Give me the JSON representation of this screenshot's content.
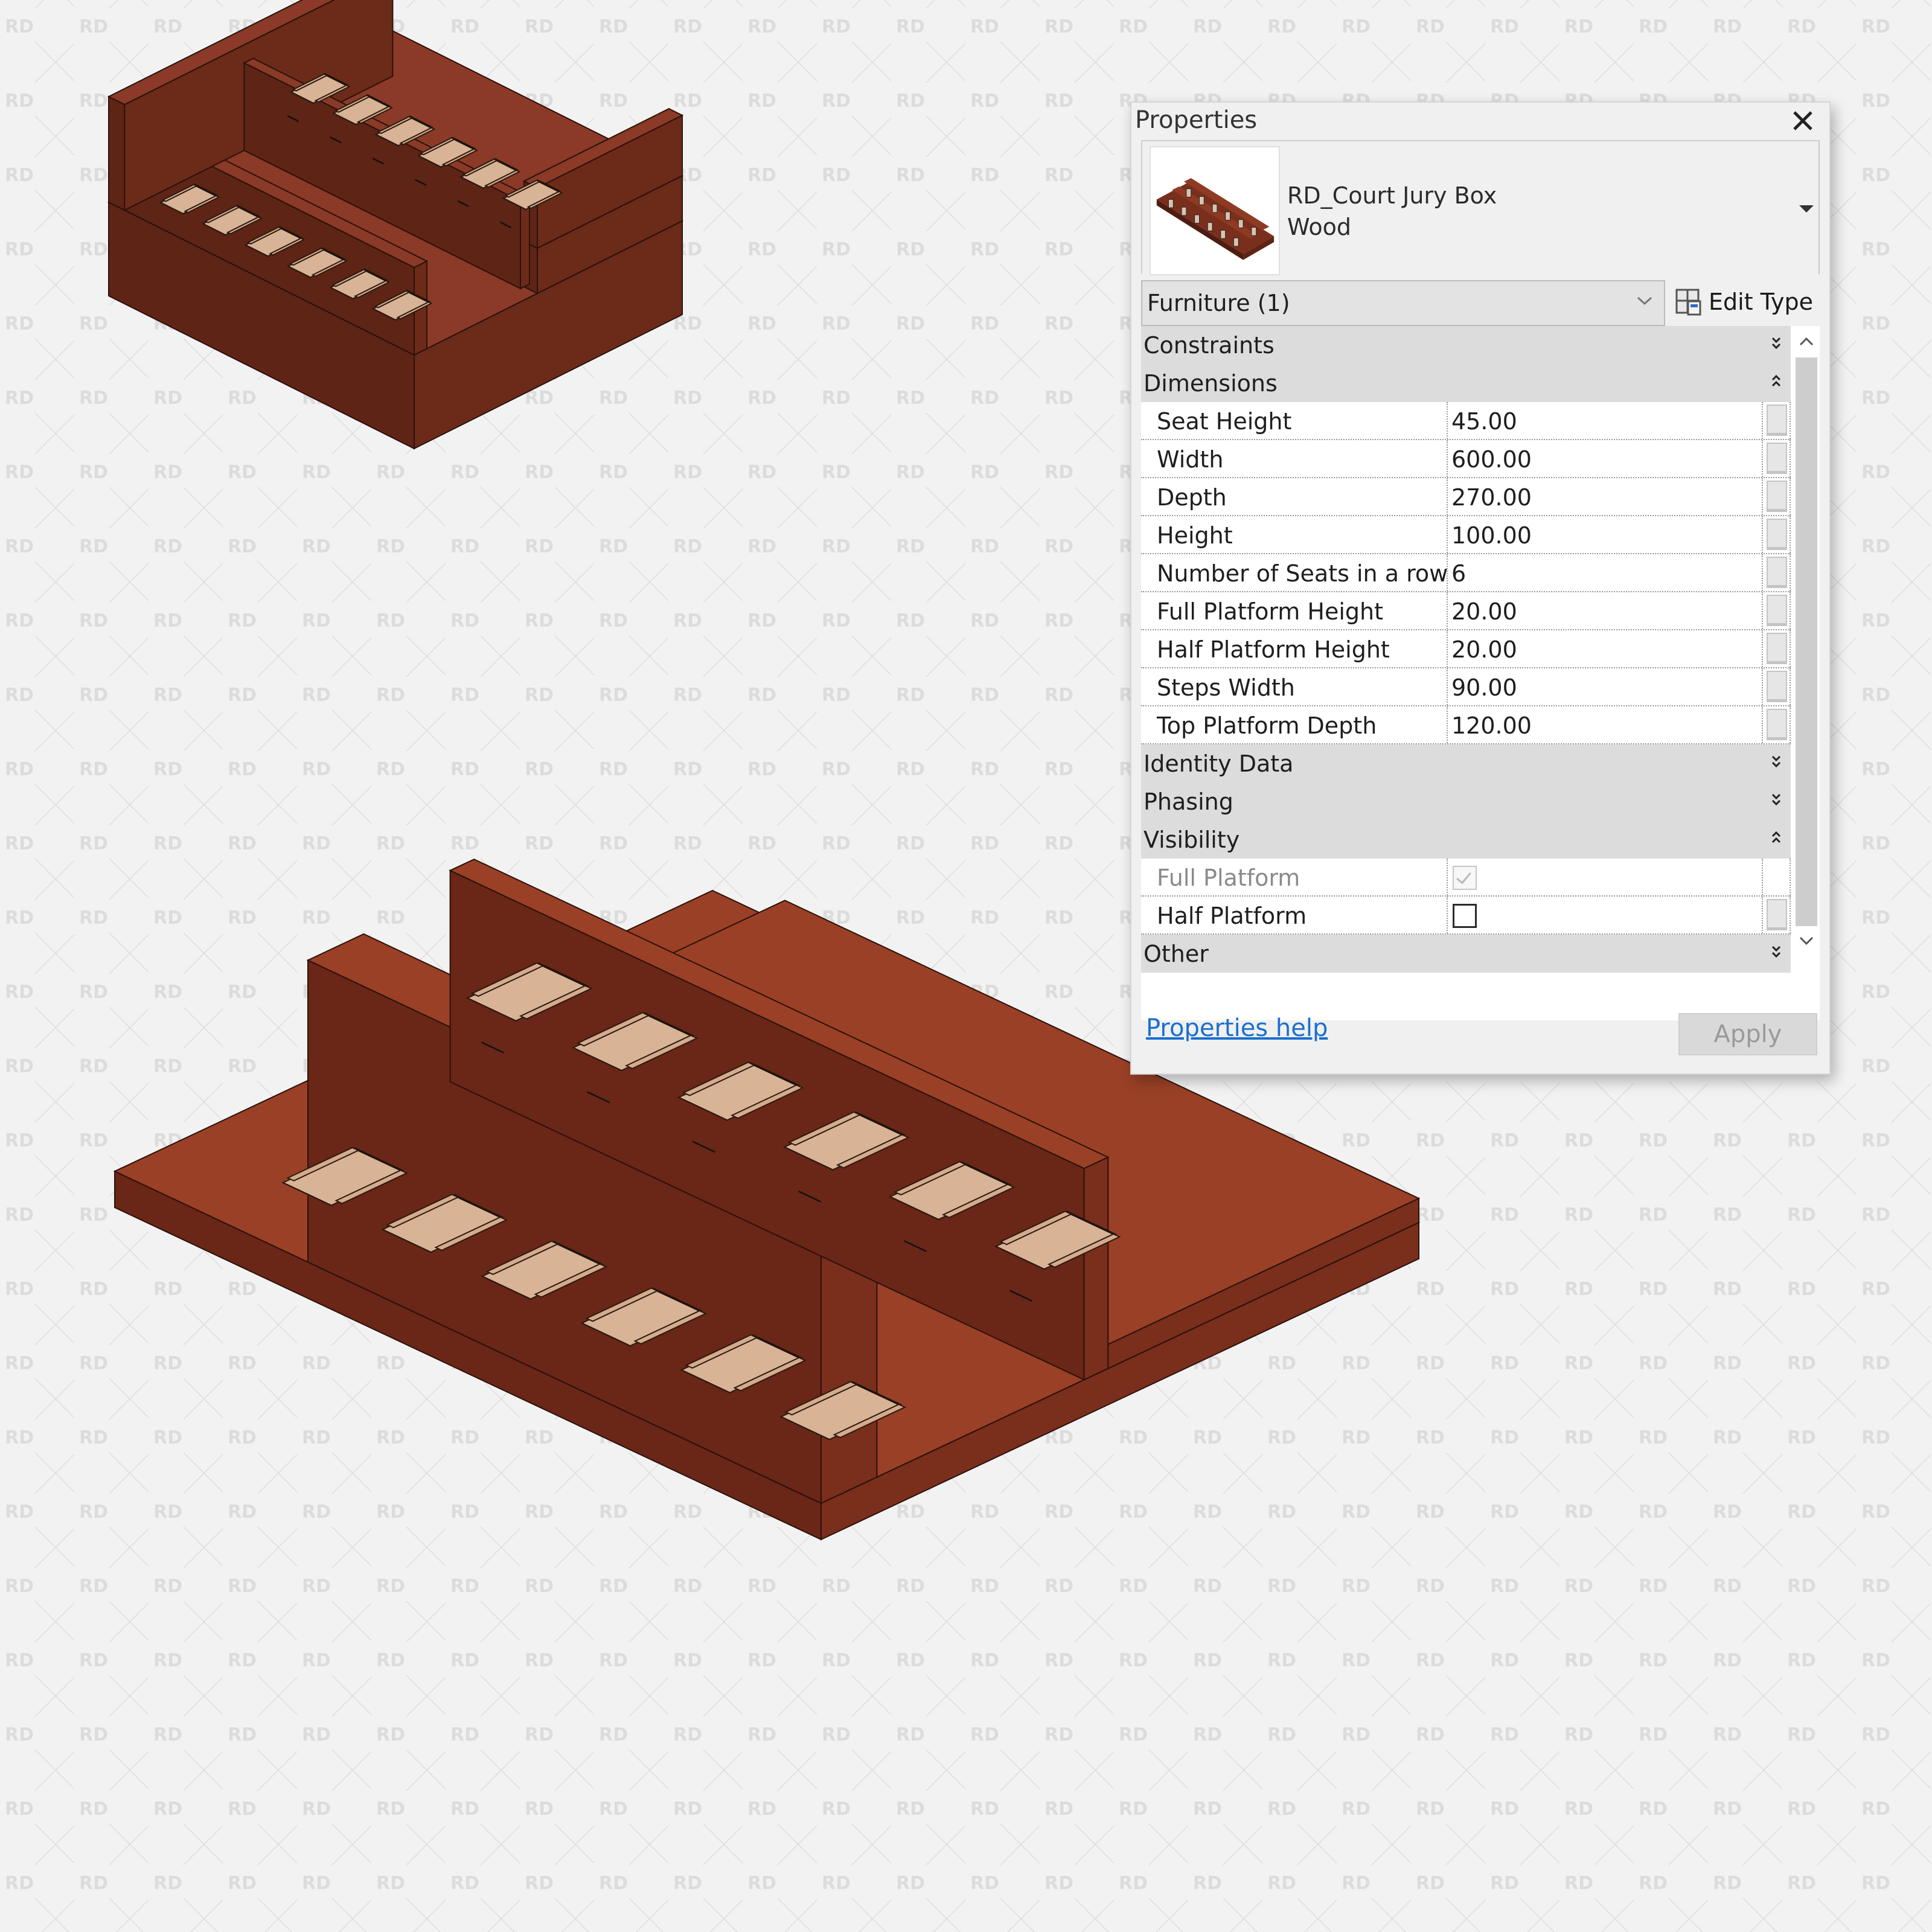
{
  "properties_palette": {
    "title": "Properties",
    "close_icon": "close-icon",
    "type_selector": {
      "family": "RD_Court Jury Box",
      "type": "Wood",
      "dropdown_icon": "triangle-down-icon"
    },
    "instance_filter": {
      "label": "Furniture (1)",
      "dropdown_icon": "chevron-down-icon"
    },
    "edit_type": {
      "label": "Edit Type",
      "icon": "edit-type-icon"
    },
    "groups": [
      {
        "label": "Constraints",
        "expanded": false
      },
      {
        "label": "Dimensions",
        "expanded": true,
        "rows": [
          {
            "name": "Seat Height",
            "value": "45.00"
          },
          {
            "name": "Width",
            "value": "600.00"
          },
          {
            "name": "Depth",
            "value": "270.00"
          },
          {
            "name": "Height",
            "value": "100.00"
          },
          {
            "name": "Number of Seats in a row",
            "value": "6"
          },
          {
            "name": "Full Platform Height",
            "value": "20.00"
          },
          {
            "name": "Half Platform Height",
            "value": "20.00"
          },
          {
            "name": "Steps Width",
            "value": "90.00"
          },
          {
            "name": "Top Platform Depth",
            "value": "120.00"
          }
        ]
      },
      {
        "label": "Identity Data",
        "expanded": false
      },
      {
        "label": "Phasing",
        "expanded": false
      },
      {
        "label": "Visibility",
        "expanded": true,
        "rows": [
          {
            "name": "Full Platform",
            "checked": true,
            "disabled": true
          },
          {
            "name": "Half Platform",
            "checked": false,
            "disabled": false
          }
        ]
      },
      {
        "label": "Other",
        "expanded": false
      }
    ],
    "help_link": "Properties help",
    "apply_label": "Apply"
  },
  "watermark": {
    "text": "RD"
  },
  "renders": [
    {
      "name": "jury-box-full-platform-view",
      "description": "Isometric view of jury box with full platform, 2 rows of 6 seats, wood finish"
    },
    {
      "name": "jury-box-half-platform-view",
      "description": "Isometric close-up view of jury box with half platform, 2 rows of 6 seats, wood finish"
    }
  ],
  "colors": {
    "background": "#f2f2f2",
    "wood": "#8a3a26",
    "wood_dark": "#5e2416",
    "wood_light": "#a24a30",
    "seat_light": "#d9b396",
    "seat_dark": "#6e5646",
    "link": "#1a6fd1",
    "group_header": "#dcdcdc"
  }
}
